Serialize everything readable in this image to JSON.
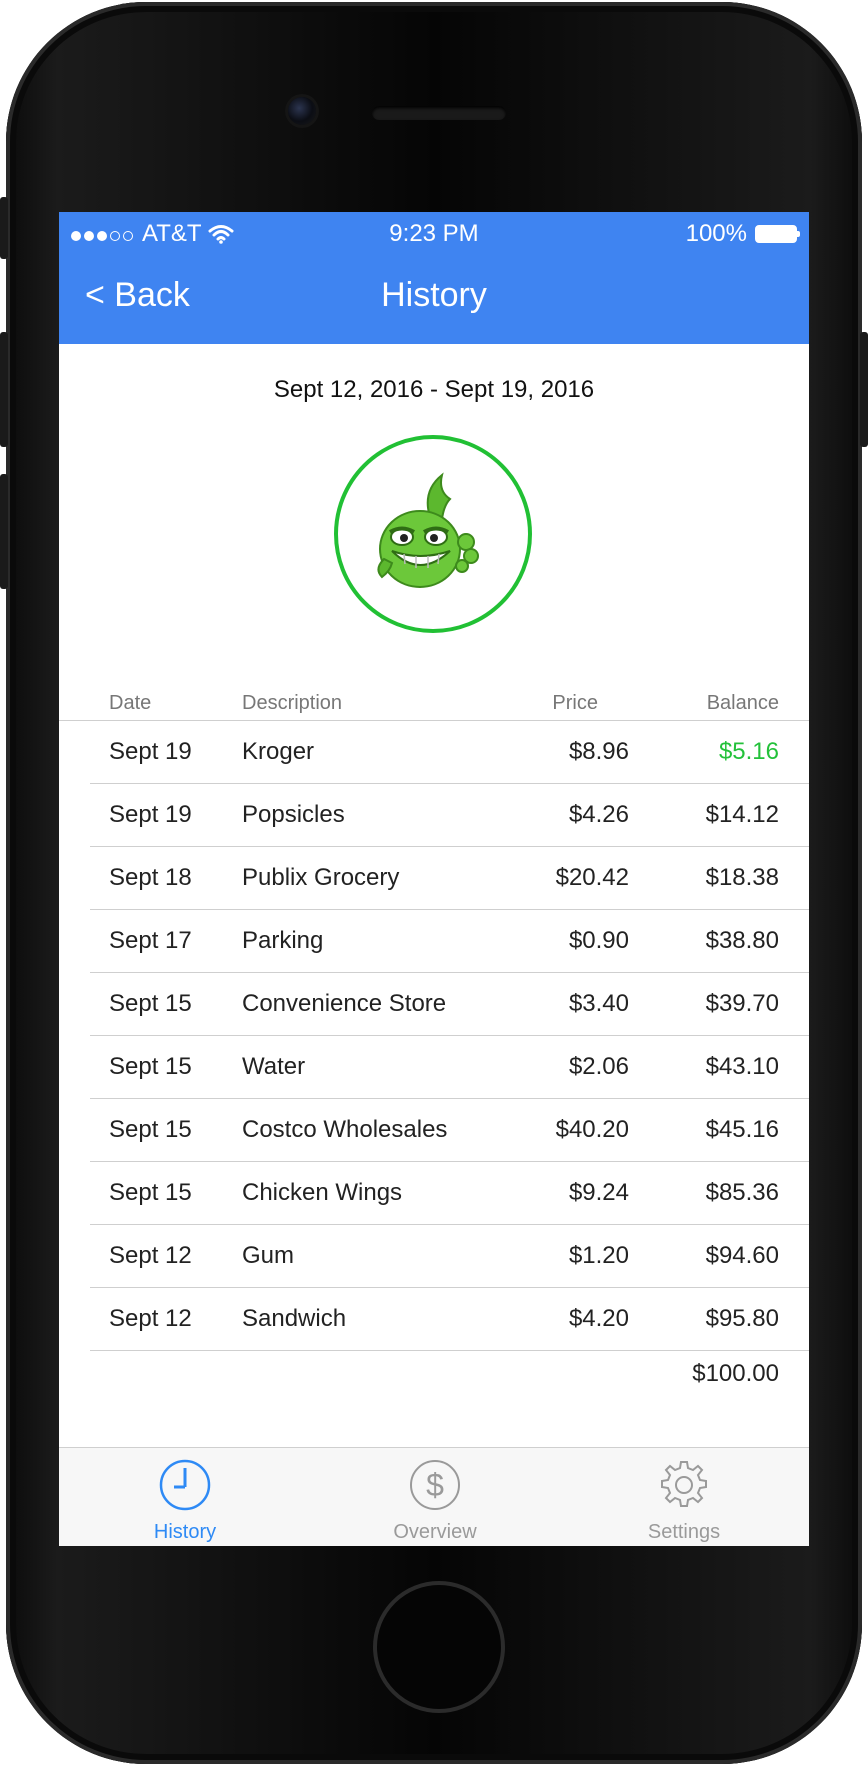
{
  "status_bar": {
    "signal_dots_filled": 3,
    "signal_dots_total": 5,
    "carrier": "AT&T",
    "time": "9:23 PM",
    "battery": "100%"
  },
  "nav": {
    "back_label": "< Back",
    "title": "History"
  },
  "date_range": "Sept 12, 2016 - Sept 19, 2016",
  "avatar_icon": "green-fish-mascot-icon",
  "table": {
    "headers": {
      "date": "Date",
      "description": "Description",
      "price": "Price",
      "balance": "Balance"
    },
    "rows": [
      {
        "date": "Sept 19",
        "description": "Kroger",
        "price": "$8.96",
        "balance": "$5.16",
        "balance_color": "#23c13a"
      },
      {
        "date": "Sept 19",
        "description": "Popsicles",
        "price": "$4.26",
        "balance": "$14.12"
      },
      {
        "date": "Sept 18",
        "description": "Publix Grocery",
        "price": "$20.42",
        "balance": "$18.38"
      },
      {
        "date": "Sept 17",
        "description": "Parking",
        "price": "$0.90",
        "balance": "$38.80"
      },
      {
        "date": "Sept 15",
        "description": "Convenience Store",
        "price": "$3.40",
        "balance": "$39.70"
      },
      {
        "date": "Sept 15",
        "description": "Water",
        "price": "$2.06",
        "balance": "$43.10"
      },
      {
        "date": "Sept 15",
        "description": "Costco Wholesales",
        "price": "$40.20",
        "balance": "$45.16"
      },
      {
        "date": "Sept 15",
        "description": "Chicken Wings",
        "price": "$9.24",
        "balance": "$85.36"
      },
      {
        "date": "Sept 12",
        "description": "Gum",
        "price": "$1.20",
        "balance": "$94.60"
      },
      {
        "date": "Sept 12",
        "description": "Sandwich",
        "price": "$4.20",
        "balance": "$95.80"
      }
    ],
    "starting_balance": "$100.00"
  },
  "tabs": [
    {
      "label": "History",
      "icon": "clock-icon",
      "active": true
    },
    {
      "label": "Overview",
      "icon": "dollar-circle-icon",
      "active": false
    },
    {
      "label": "Settings",
      "icon": "gear-icon",
      "active": false
    }
  ],
  "colors": {
    "header_blue": "#3f84f1",
    "accent_green": "#21c034",
    "tab_active": "#2e8af5",
    "tab_inactive": "#9a9a9a"
  }
}
